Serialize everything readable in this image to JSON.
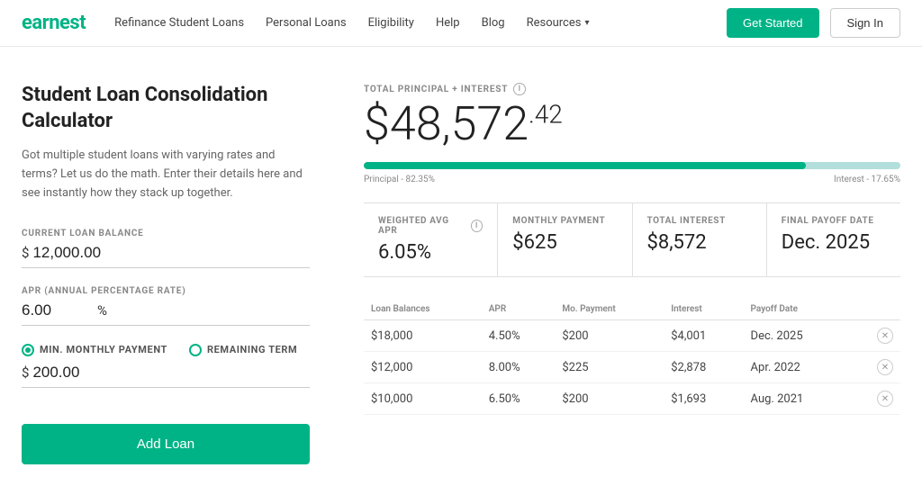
{
  "nav": {
    "logo": "earnest",
    "links": [
      {
        "label": "Refinance Student Loans",
        "href": "#"
      },
      {
        "label": "Personal Loans",
        "href": "#"
      },
      {
        "label": "Eligibility",
        "href": "#"
      },
      {
        "label": "Help",
        "href": "#"
      },
      {
        "label": "Blog",
        "href": "#"
      },
      {
        "label": "Resources",
        "href": "#",
        "hasDropdown": true
      }
    ],
    "get_started": "Get Started",
    "sign_in": "Sign In"
  },
  "left": {
    "title": "Student Loan Consolidation Calculator",
    "description": "Got multiple student loans with varying rates and terms? Let us do the math. Enter their details here and see instantly how they stack up together.",
    "current_loan_balance_label": "CURRENT LOAN BALANCE",
    "current_loan_balance_currency": "$",
    "current_loan_balance_value": "12,000.00",
    "apr_label": "APR (ANNUAL PERCENTAGE RATE)",
    "apr_value": "6.00",
    "apr_percent": "%",
    "payment_options": [
      {
        "label": "MIN. MONTHLY PAYMENT",
        "selected": true
      },
      {
        "label": "REMAINING TERM",
        "selected": false
      }
    ],
    "min_payment_currency": "$",
    "min_payment_value": "200.00",
    "add_loan_button": "Add Loan"
  },
  "right": {
    "total_label": "TOTAL PRINCIPAL + INTEREST",
    "total_dollars": "$48,572",
    "total_cents": ".42",
    "progress_principal_label": "Principal - 82.35%",
    "progress_interest_label": "Interest - 17.65%",
    "progress_principal_pct": 82.35,
    "stats": [
      {
        "label": "WEIGHTED AVG APR",
        "value": "6.05%",
        "has_info": true
      },
      {
        "label": "MONTHLY PAYMENT",
        "value": "$625"
      },
      {
        "label": "TOTAL INTEREST",
        "value": "$8,572"
      },
      {
        "label": "FINAL PAYOFF DATE",
        "value": "Dec. 2025"
      }
    ],
    "table": {
      "headers": [
        "Loan Balances",
        "APR",
        "Mo. Payment",
        "Interest",
        "Payoff Date",
        ""
      ],
      "rows": [
        {
          "balance": "$18,000",
          "apr": "4.50%",
          "payment": "$200",
          "interest": "$4,001",
          "payoff": "Dec. 2025"
        },
        {
          "balance": "$12,000",
          "apr": "8.00%",
          "payment": "$225",
          "interest": "$2,878",
          "payoff": "Apr. 2022"
        },
        {
          "balance": "$10,000",
          "apr": "6.50%",
          "payment": "$200",
          "interest": "$1,693",
          "payoff": "Aug. 2021"
        }
      ]
    }
  }
}
